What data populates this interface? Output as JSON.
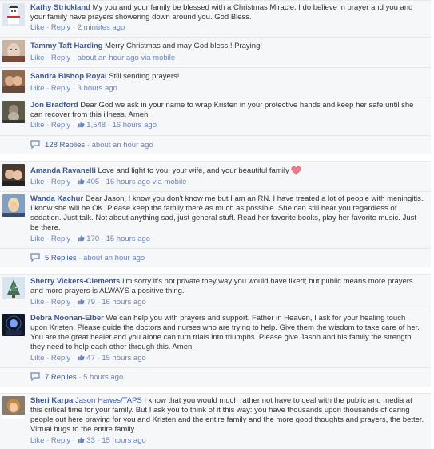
{
  "comments": [
    {
      "author": "Kathy Strickland",
      "tagged": "",
      "text": "My you and your family be blessed with a Christmas Miracle. I do believe in prayer and you and your family have prayers showering down around you. God Bless.",
      "like": "Like",
      "reply": "Reply",
      "likes": "",
      "time": "2 minutes ago",
      "via": ""
    },
    {
      "author": "Tammy Taft Harding",
      "tagged": "",
      "text": "Merry Christmas and may God bless ! Praying!",
      "like": "Like",
      "reply": "Reply",
      "likes": "",
      "time": "about an hour ago via mobile",
      "via": ""
    },
    {
      "author": "Sandra Bishop Royal",
      "tagged": "",
      "text": "Still sending prayers!",
      "like": "Like",
      "reply": "Reply",
      "likes": "",
      "time": "3 hours ago",
      "via": ""
    },
    {
      "author": "Jon Bradford",
      "tagged": "",
      "text": "Dear God we ask in your name to wrap Kristen in your protective hands and keep her safe until she can recover from this illness. Amen.",
      "like": "Like",
      "reply": "Reply",
      "likes": "1,548",
      "time": "16 hours ago",
      "via": ""
    },
    {
      "author": "Amanda Ravanelli",
      "tagged": "",
      "text": "Love and light to you, your wife, and your beautiful family",
      "like": "Like",
      "reply": "Reply",
      "likes": "405",
      "time": "16 hours ago via mobile",
      "via": ""
    },
    {
      "author": "Wanda Kachur",
      "tagged": "",
      "text": "Dear Jason, I know you don't know me but I am an RN. I have treated a lot of people with meningitis. I know she will be OK. Please keep the family there as much as possible. She can still hear you regardless of sedation. Just talk. Not about anything sad, just general stuff. Read her favorite books, play her favorite music. Just be there.",
      "like": "Like",
      "reply": "Reply",
      "likes": "170",
      "time": "15 hours ago",
      "via": ""
    },
    {
      "author": "Sherry Vickers-Clements",
      "tagged": "",
      "text": "I'm sorry it's not private they way you would have liked; but public means more prayers and more prayers is ALWAYS a positive thing.",
      "like": "Like",
      "reply": "Reply",
      "likes": "79",
      "time": "16 hours ago",
      "via": ""
    },
    {
      "author": "Debra Noonan-Elber",
      "tagged": "",
      "text": "We can help you with prayers and support. Father in Heaven, I ask for your healing touch upon Kristen. Please guide the doctors and nurses who are trying to help. Give them the wisdom to take care of her. You are the great healer and you alone can turn trials into triumphs. Please give Jason and his family the strength they need to help each other through this. Amen.",
      "like": "Like",
      "reply": "Reply",
      "likes": "47",
      "time": "15 hours ago",
      "via": ""
    },
    {
      "author": "Sheri Karpa",
      "tagged": "Jason Hawes/TAPS",
      "text": "I know that you would much rather not have to deal with the public and media at this critical time for your family. But I ask you to think of it this way: you have thousands upon thousands of caring people out here praying for you and Kristen and the entire family and the more good thoughts and prayers, the better. Virtual hugs to the entire family.",
      "like": "Like",
      "reply": "Reply",
      "likes": "33",
      "time": "15 hours ago",
      "via": ""
    }
  ],
  "reply_threads": [
    {
      "count": "128 Replies",
      "ago": "about an hour ago"
    },
    {
      "count": "5 Replies",
      "ago": "about an hour ago"
    },
    {
      "count": "7 Replies",
      "ago": "5 hours ago"
    }
  ],
  "colors": {
    "link": "#3b5998",
    "meta": "#6d84b4",
    "background": "#f6f7f9",
    "heart": "#e0245e"
  },
  "icons": [
    "like-thumb-icon",
    "heart-icon",
    "reply-bubble-icon"
  ]
}
